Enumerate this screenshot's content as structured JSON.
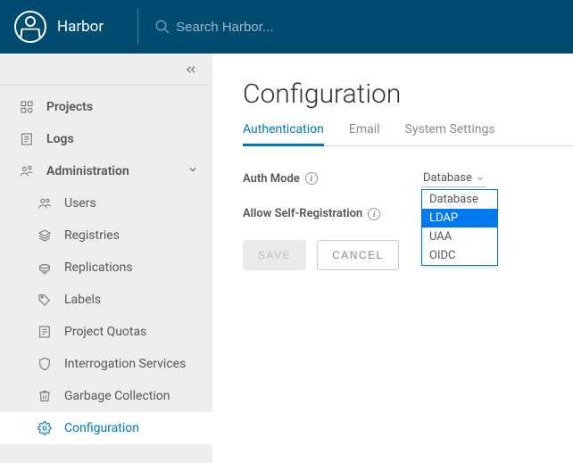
{
  "header": {
    "brand": "Harbor",
    "search_placeholder": "Search Harbor..."
  },
  "sidebar": {
    "projects": "Projects",
    "logs": "Logs",
    "admin": "Administration",
    "items": [
      {
        "label": "Users"
      },
      {
        "label": "Registries"
      },
      {
        "label": "Replications"
      },
      {
        "label": "Labels"
      },
      {
        "label": "Project Quotas"
      },
      {
        "label": "Interrogation Services"
      },
      {
        "label": "Garbage Collection"
      },
      {
        "label": "Configuration"
      }
    ]
  },
  "main": {
    "title": "Configuration",
    "tabs": [
      {
        "label": "Authentication",
        "active": true
      },
      {
        "label": "Email"
      },
      {
        "label": "System Settings"
      }
    ],
    "auth_mode_label": "Auth Mode",
    "auth_mode_value": "Database",
    "auth_mode_options": [
      "Database",
      "LDAP",
      "UAA",
      "OIDC"
    ],
    "auth_mode_highlight": "LDAP",
    "allow_self_reg_label": "Allow Self-Registration",
    "save_label": "SAVE",
    "cancel_label": "CANCEL"
  }
}
